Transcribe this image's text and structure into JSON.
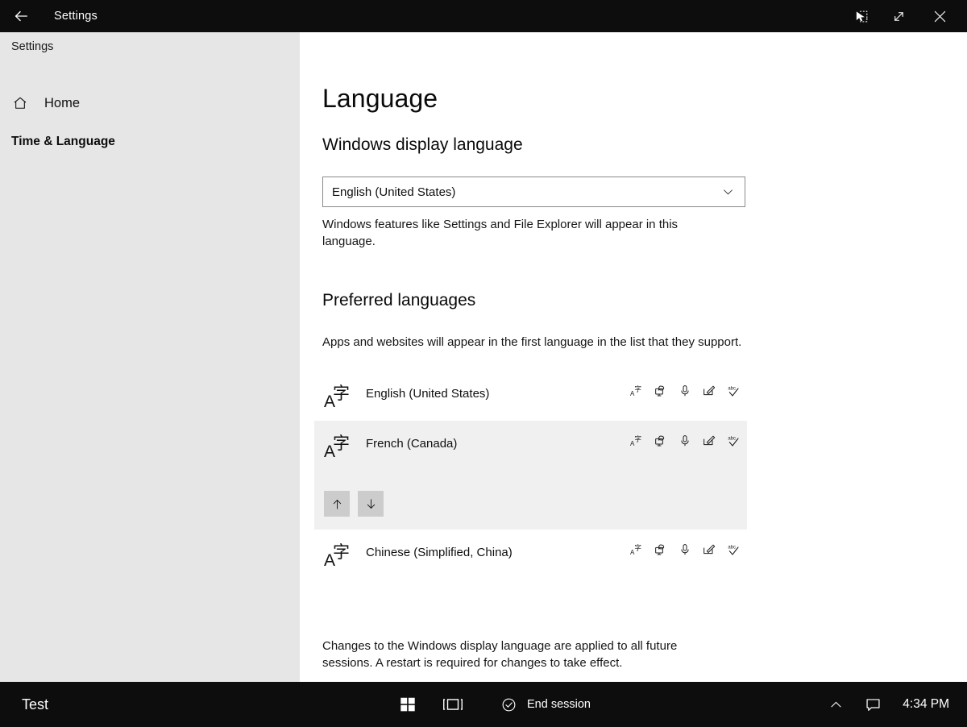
{
  "titlebar": {
    "back_icon": "back-arrow-icon",
    "title": "Settings",
    "buttons": [
      {
        "icon": "remote-input-icon",
        "name": "remote-input-button"
      },
      {
        "icon": "expand-diagonal-icon",
        "name": "maximize-button"
      },
      {
        "icon": "close-icon",
        "name": "close-button"
      }
    ]
  },
  "sidebar": {
    "app_title": "Settings",
    "home_label": "Home",
    "home_icon": "home-icon",
    "category": "Time & Language"
  },
  "main": {
    "page_title": "Language",
    "display_language": {
      "heading": "Windows display language",
      "selected": "English (United States)",
      "chevron_icon": "chevron-down-icon",
      "description": "Windows features like Settings and File Explorer will appear in this language."
    },
    "preferred_languages": {
      "heading": "Preferred languages",
      "description": "Apps and websites will appear in the first language in the list that they support.",
      "feature_icons": [
        "language-pack-icon",
        "display-language-icon",
        "speech-microphone-icon",
        "handwriting-pen-icon",
        "spellcheck-abc-icon"
      ],
      "items": [
        {
          "name": "English (United States)",
          "icon": "language-a-zi-icon",
          "selected": false
        },
        {
          "name": "French (Canada)",
          "icon": "language-a-zi-icon",
          "selected": true,
          "move_up_icon": "arrow-up-icon",
          "move_down_icon": "arrow-down-icon"
        },
        {
          "name": "Chinese (Simplified, China)",
          "icon": "language-a-zi-icon",
          "selected": false
        }
      ]
    },
    "footer_note": "Changes to the Windows display language are applied to all future sessions. A restart is required for changes to take effect."
  },
  "taskbar": {
    "session_label": "Test",
    "start_icon": "windows-start-icon",
    "taskview_icon": "task-view-icon",
    "end_session_icon": "check-circle-icon",
    "end_session_label": "End session",
    "show_hidden_icon": "chevron-up-icon",
    "action_center_icon": "notification-bubble-icon",
    "clock": "4:34 PM"
  },
  "colors": {
    "chrome_black": "#0d0d0d",
    "sidebar_gray": "#e6e6e6",
    "selected_row": "#f0f0f0",
    "move_button": "#cccccc",
    "content_white": "#ffffff"
  }
}
